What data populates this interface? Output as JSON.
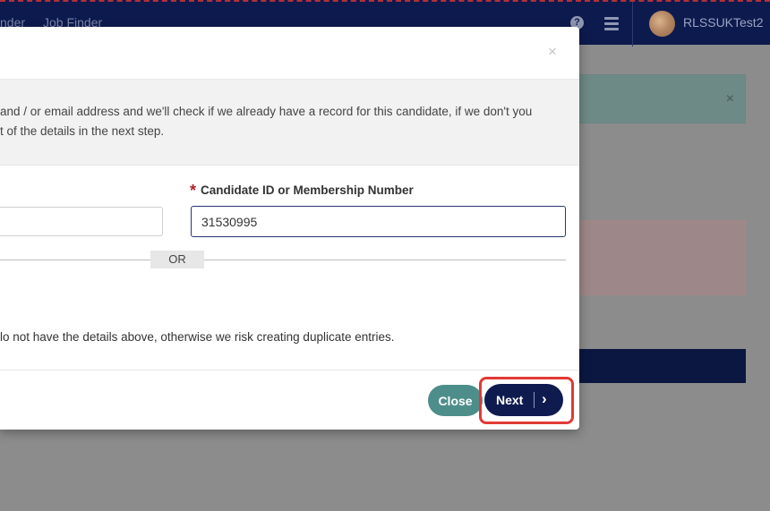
{
  "topbar": {
    "nav_partial": "nder",
    "nav_job_finder": "Job Finder",
    "help_glyph": "?",
    "username": "RLSSUKTest2"
  },
  "background": {
    "alert_close": "×"
  },
  "modal": {
    "close_glyph": "×",
    "intro_line1": "and / or email address and we'll check if we already have a record for this candidate, if we don't you",
    "intro_line2": "t of the details in the next step.",
    "field_required_marker": "*",
    "field_label": "Candidate ID or Membership Number",
    "field_value": "31530995",
    "or_label": "OR",
    "warning_text": "lo not have the details above, otherwise we risk creating duplicate entries.",
    "close_button": "Close",
    "next_button": "Next",
    "next_chevron": "›"
  },
  "colors": {
    "navy": "#0d1a4e",
    "teal_button": "#4d8e8b",
    "highlight_red": "#e23a35",
    "required_red": "#b2202a"
  }
}
